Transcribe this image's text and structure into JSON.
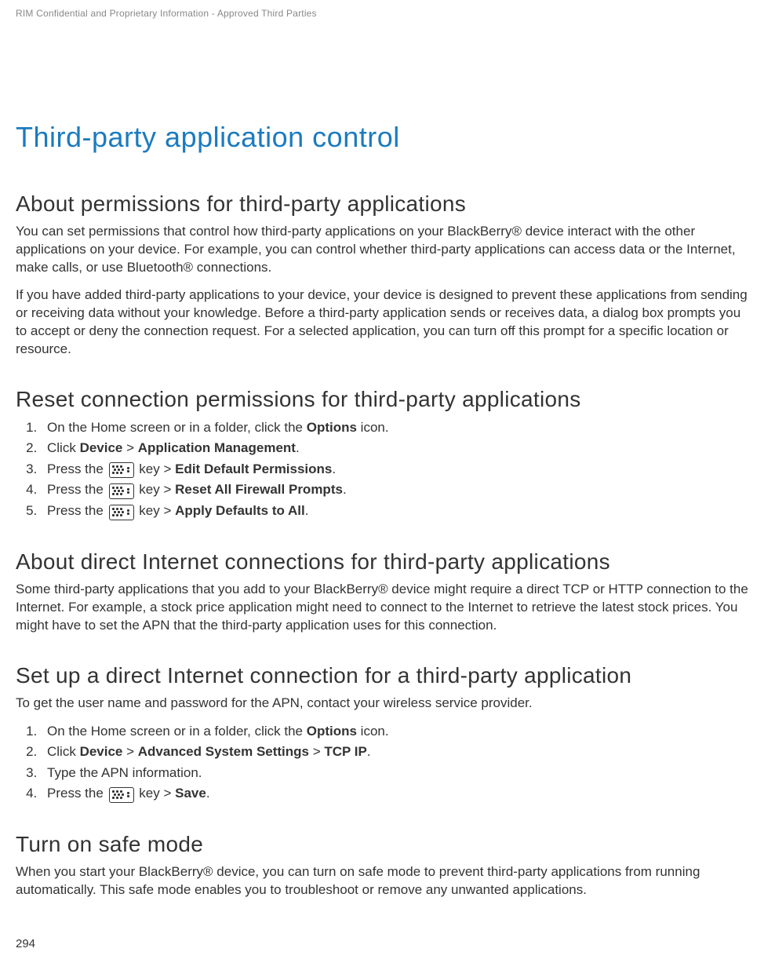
{
  "header": {
    "confidential": "RIM Confidential and Proprietary Information - Approved Third Parties"
  },
  "title": "Third-party application control",
  "sections": {
    "about_permissions": {
      "heading": "About permissions for third-party applications",
      "para1": "You can set permissions that control how third-party applications on your BlackBerry® device interact with the other applications on your device. For example, you can control whether third-party applications can access data or the Internet, make calls, or use Bluetooth® connections.",
      "para2": "If you have added third-party applications to your device, your device is designed to prevent these applications from sending or receiving data without your knowledge. Before a third-party application sends or receives data, a dialog box prompts you to accept or deny the connection request. For a selected application, you can turn off this prompt for a specific location or resource."
    },
    "reset_permissions": {
      "heading": "Reset connection permissions for third-party applications",
      "steps": {
        "s1_pre": "On the Home screen or in a folder, click the ",
        "s1_b1": "Options",
        "s1_post": " icon.",
        "s2_pre": "Click ",
        "s2_b1": "Device",
        "s2_mid": " > ",
        "s2_b2": "Application Management",
        "s2_post": ".",
        "s3_pre": "Press the ",
        "s3_mid": " key > ",
        "s3_b1": "Edit Default Permissions",
        "s3_post": ".",
        "s4_pre": "Press the ",
        "s4_mid": " key > ",
        "s4_b1": "Reset All Firewall Prompts",
        "s4_post": ".",
        "s5_pre": "Press the ",
        "s5_mid": " key > ",
        "s5_b1": "Apply Defaults to All",
        "s5_post": "."
      }
    },
    "about_direct": {
      "heading": "About direct Internet connections for third-party applications",
      "para1": "Some third-party applications that you add to your BlackBerry® device might require a direct TCP or HTTP connection to the Internet. For example, a stock price application might need to connect to the Internet to retrieve the latest stock prices. You might have to set the APN that the third-party application uses for this connection."
    },
    "setup_direct": {
      "heading": "Set up a direct Internet connection for a third-party application",
      "intro": "To get the user name and password for the APN, contact your wireless service provider.",
      "steps": {
        "s1_pre": "On the Home screen or in a folder, click the ",
        "s1_b1": "Options",
        "s1_post": " icon.",
        "s2_pre": "Click ",
        "s2_b1": "Device",
        "s2_mid1": " > ",
        "s2_b2": "Advanced System Settings",
        "s2_mid2": " > ",
        "s2_b3": "TCP IP",
        "s2_post": ".",
        "s3_text": "Type the APN information.",
        "s4_pre": "Press the ",
        "s4_mid": " key > ",
        "s4_b1": "Save",
        "s4_post": "."
      }
    },
    "safe_mode": {
      "heading": "Turn on safe mode",
      "para1": "When you start your BlackBerry® device, you can turn on safe mode to prevent third-party applications from running automatically. This safe mode enables you to troubleshoot or remove any unwanted applications."
    }
  },
  "page_number": "294"
}
